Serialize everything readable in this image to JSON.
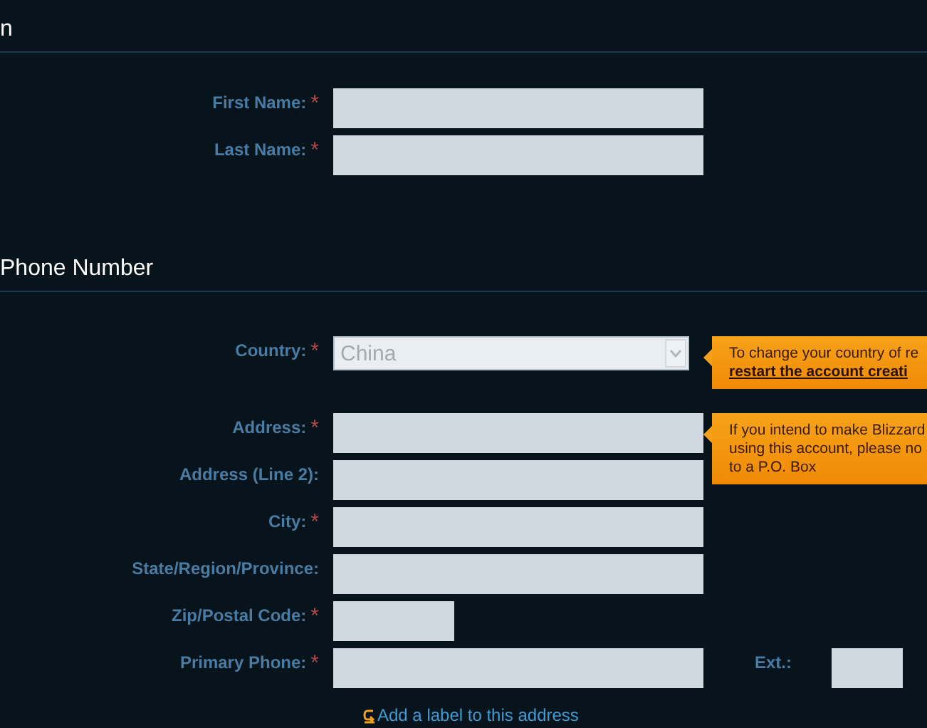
{
  "sections": [
    {
      "title": "n",
      "rows": [
        {
          "kind": "text",
          "label": "First Name:",
          "required_mark": "*"
        },
        {
          "kind": "text",
          "label": "Last Name:",
          "required_mark": "*"
        }
      ]
    },
    {
      "title": "Phone Number",
      "rows": [
        {
          "kind": "select",
          "label": "Country:",
          "required_mark": "*",
          "value": "China",
          "disabled": true,
          "tip": [
            {
              "kind": "text",
              "text": "To change your country of re"
            },
            {
              "kind": "link",
              "text": "restart the account creati"
            }
          ]
        },
        {
          "kind": "text",
          "label": "Address:",
          "required_mark": "*",
          "tip": [
            {
              "kind": "text",
              "text": "If you intend to make Blizzard"
            },
            {
              "kind": "text",
              "text": "using this account, please no"
            },
            {
              "kind": "text",
              "text": "to a P.O. Box"
            }
          ]
        },
        {
          "kind": "text",
          "label": "Address (Line 2):"
        },
        {
          "kind": "text",
          "label": "City:",
          "required_mark": "*"
        },
        {
          "kind": "text",
          "label": "State/Region/Province:"
        },
        {
          "kind": "short",
          "label": "Zip/Postal Code:",
          "required_mark": "*"
        },
        {
          "kind": "text",
          "label": "Primary Phone:",
          "required_mark": "*",
          "ext": {
            "label": "Ext.:"
          }
        }
      ],
      "link": "Add a label to this address"
    }
  ]
}
